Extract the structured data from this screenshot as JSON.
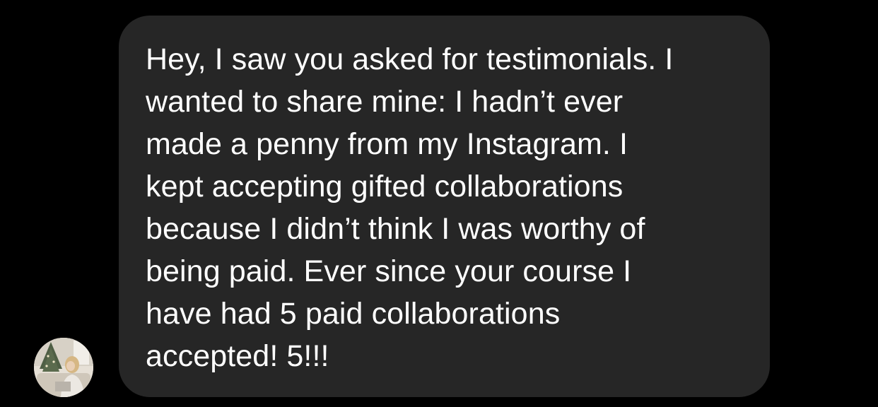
{
  "conversation": {
    "messages": [
      {
        "sender": "other",
        "text": "Hey, I saw you asked for testimonials. I\nwanted to share mine: I hadn’t ever\nmade a penny from my Instagram. I\nkept accepting gifted collaborations\nbecause I didn’t think I was worthy of\nbeing paid. Ever since your course I\nhave had 5 paid collaborations\naccepted! 5!!!"
      }
    ]
  },
  "colors": {
    "background": "#000000",
    "bubble": "#262626",
    "text": "#ffffff"
  },
  "icons": {
    "avatar": "sender-avatar"
  }
}
